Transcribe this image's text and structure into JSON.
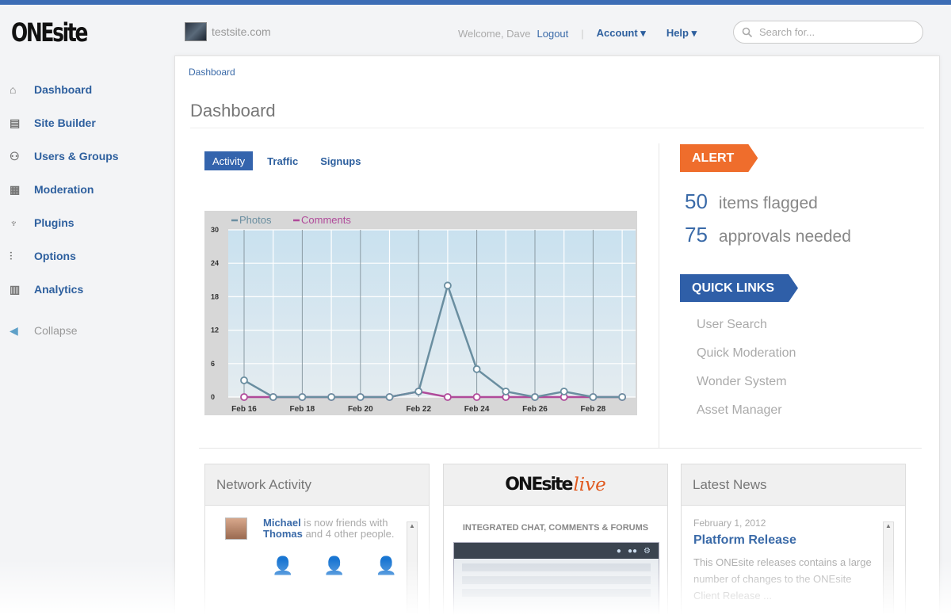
{
  "header": {
    "logo": "ONEsite",
    "site": "testsite.com",
    "welcome": "Welcome, Dave",
    "logout": "Logout",
    "account": "Account ▾",
    "help": "Help ▾",
    "search_placeholder": "Search for..."
  },
  "sidebar": {
    "items": [
      {
        "label": "Dashboard",
        "icon": "home-icon"
      },
      {
        "label": "Site Builder",
        "icon": "layout-icon"
      },
      {
        "label": "Users & Groups",
        "icon": "users-icon"
      },
      {
        "label": "Moderation",
        "icon": "moderation-icon"
      },
      {
        "label": "Plugins",
        "icon": "plug-icon"
      },
      {
        "label": "Options",
        "icon": "options-icon"
      },
      {
        "label": "Analytics",
        "icon": "analytics-icon"
      }
    ],
    "collapse": "Collapse"
  },
  "breadcrumb": "Dashboard",
  "page_title": "Dashboard",
  "tabs": [
    "Activity",
    "Traffic",
    "Signups"
  ],
  "chart_data": {
    "type": "line",
    "x": [
      "Feb 16",
      "Feb 17",
      "Feb 18",
      "Feb 19",
      "Feb 20",
      "Feb 21",
      "Feb 22",
      "Feb 23",
      "Feb 24",
      "Feb 25",
      "Feb 26",
      "Feb 27",
      "Feb 28",
      "Feb 29"
    ],
    "x_ticks": [
      "Feb 16",
      "Feb 18",
      "Feb 20",
      "Feb 22",
      "Feb 24",
      "Feb 26",
      "Feb 28"
    ],
    "y_ticks": [
      "0",
      "6",
      "12",
      "18",
      "24",
      "30"
    ],
    "ylim": [
      0,
      30
    ],
    "legend_position": "top-left",
    "grid": true,
    "series": [
      {
        "name": "Photos",
        "color": "#6a8ea0",
        "values": [
          3,
          0,
          0,
          0,
          0,
          0,
          1,
          20,
          5,
          1,
          0,
          1,
          0,
          0
        ]
      },
      {
        "name": "Comments",
        "color": "#b04a9a",
        "values": [
          0,
          0,
          0,
          0,
          0,
          0,
          1,
          0,
          0,
          0,
          0,
          0,
          0,
          0
        ]
      }
    ]
  },
  "alert": {
    "label": "ALERT",
    "color": "#ef6d2c",
    "stats": [
      {
        "value": "50",
        "label": "items flagged"
      },
      {
        "value": "75",
        "label": "approvals needed"
      }
    ]
  },
  "quick_links": {
    "label": "QUICK LINKS",
    "color": "#2f5fa8",
    "items": [
      "User Search",
      "Quick Moderation",
      "Wonder System",
      "Asset Manager"
    ]
  },
  "network_activity": {
    "title": "Network Activity",
    "name1": "Michael",
    "text1": " is now friends with ",
    "name2": "Thomas",
    "text2": " and 4 other people."
  },
  "live": {
    "logo_main": "ONEsite",
    "logo_live": "live",
    "subtitle": "INTEGRATED CHAT, COMMENTS & FORUMS"
  },
  "news": {
    "title": "Latest News",
    "date": "February 1, 2012",
    "headline": "Platform Release",
    "text": "This ONEsite releases contains a large number of changes to the ONEsite Client Release ..."
  }
}
